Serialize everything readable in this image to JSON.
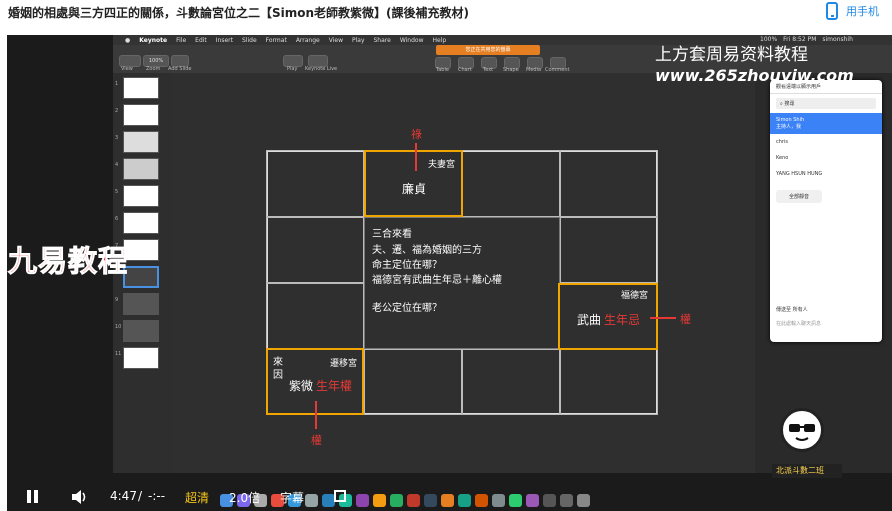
{
  "page": {
    "title": "婚姻的相處與三方四正的關係，斗數論宮位之二【Simon老師教紫微】(課後補充教材)",
    "mobile_label": "用手机"
  },
  "mac": {
    "menu": [
      "Keynote",
      "File",
      "Edit",
      "Insert",
      "Slide",
      "Format",
      "Arrange",
      "View",
      "Play",
      "Share",
      "Window",
      "Help"
    ],
    "clock": "Fri 8:52 PM",
    "user": "simonshih",
    "battery": "100%"
  },
  "keynote": {
    "toolbar_labels": [
      "View",
      "Zoom",
      "Add Slide",
      "Play",
      "Keynote Live",
      "Table",
      "Chart",
      "Text",
      "Shape",
      "Media",
      "Comment"
    ],
    "zoom_value": "100%",
    "banner": "您正在共用您的螢幕",
    "slide_numbers": [
      "1",
      "2",
      "3",
      "4",
      "5",
      "6",
      "7",
      "8",
      "9",
      "10",
      "11"
    ]
  },
  "slide": {
    "spouse_palace": "夫妻宮",
    "lianzhen": "廉貞",
    "top_label": "祿",
    "center_lines": [
      "三合來看",
      "夫、遷、福為婚姻的三方",
      "命主定位在哪？",
      "福德宮有武曲生年忌＋離心權",
      "",
      "老公定位在哪？"
    ],
    "fude_palace": "福德宮",
    "wuqu": "武曲",
    "wuqu_ji": "生年忌",
    "right_label": "權",
    "migration_palace": "遷移宮",
    "laiyin": "來因",
    "ziwei": "紫微",
    "ziwei_quan": "生年權",
    "bottom_label": "權"
  },
  "watermarks": {
    "line1": "上方套周易资料教程",
    "line2": "www.265zhouyiw.com",
    "brand": "九易教程",
    "logo_label": "北派斗數二班"
  },
  "zoom_panel": {
    "header": "觀看遠端以顯示用戶",
    "search": "搜尋",
    "participants": [
      {
        "name": "Simon Shih",
        "role": "主持人，我"
      },
      {
        "name": "chris",
        "role": ""
      },
      {
        "name": "Keno",
        "role": ""
      },
      {
        "name": "YANG HSUN HUNG",
        "role": ""
      }
    ],
    "mute_all": "全部靜音",
    "to_label": "傳送至",
    "to_value": "所有人",
    "input_placeholder": "在此處輸入聊天訊息"
  },
  "controls": {
    "time": "4:47",
    "separator": "/",
    "duration": "-:--",
    "quality": "超清",
    "speed": "2.0倍",
    "subtitle": "字幕"
  },
  "colors": {
    "accent_red": "#e53935",
    "orange_box": "#f0a500",
    "link_blue": "#1e88e5",
    "quality_yellow": "#f5c518"
  }
}
